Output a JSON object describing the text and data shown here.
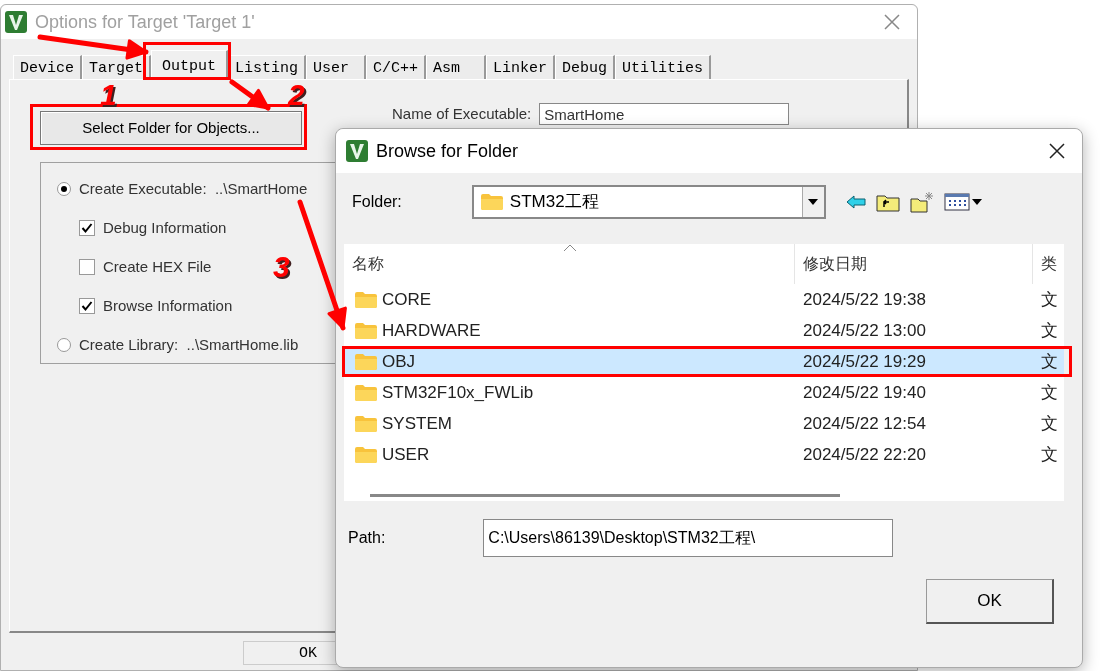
{
  "options_window": {
    "title": "Options for Target 'Target 1'",
    "tabs": [
      {
        "label": "Device",
        "selected": false
      },
      {
        "label": "Target",
        "selected": false
      },
      {
        "label": "Output",
        "selected": true
      },
      {
        "label": "Listing",
        "selected": false
      },
      {
        "label": "User",
        "selected": false
      },
      {
        "label": "C/C++",
        "selected": false
      },
      {
        "label": "Asm",
        "selected": false
      },
      {
        "label": "Linker",
        "selected": false
      },
      {
        "label": "Debug",
        "selected": false
      },
      {
        "label": "Utilities",
        "selected": false
      }
    ],
    "select_folder_button": "Select Folder for Objects...",
    "name_of_executable": {
      "label": "Name of Executable:",
      "value": "SmartHome"
    },
    "output_options": [
      {
        "kind": "radio",
        "label": "Create Executable:  ..\\SmartHome",
        "selected": true
      },
      {
        "kind": "checkbox",
        "label": "Debug Information",
        "checked": true
      },
      {
        "kind": "checkbox",
        "label": "Create HEX File",
        "checked": false
      },
      {
        "kind": "checkbox",
        "label": "Browse Information",
        "checked": true
      },
      {
        "kind": "radio",
        "label": "Create Library:  ..\\SmartHome.lib",
        "selected": false
      }
    ],
    "ok_button": "OK"
  },
  "browse_dialog": {
    "title": "Browse for Folder",
    "folder_label": "Folder:",
    "folder_value": "STM32工程",
    "columns": [
      "名称",
      "修改日期",
      "类"
    ],
    "rows": [
      {
        "name": "CORE",
        "modified": "2024/5/22 19:38",
        "type": "文",
        "selected": false
      },
      {
        "name": "HARDWARE",
        "modified": "2024/5/22 13:00",
        "type": "文",
        "selected": false
      },
      {
        "name": "OBJ",
        "modified": "2024/5/22 19:29",
        "type": "文",
        "selected": true
      },
      {
        "name": "STM32F10x_FWLib",
        "modified": "2024/5/22 19:40",
        "type": "文",
        "selected": false
      },
      {
        "name": "SYSTEM",
        "modified": "2024/5/22 12:54",
        "type": "文",
        "selected": false
      },
      {
        "name": "USER",
        "modified": "2024/5/22 22:20",
        "type": "文",
        "selected": false
      }
    ],
    "path_label": "Path:",
    "path_value": "C:\\Users\\86139\\Desktop\\STM32工程\\",
    "ok_button": "OK"
  },
  "annotations": {
    "steps": [
      "1",
      "2",
      "3"
    ]
  }
}
